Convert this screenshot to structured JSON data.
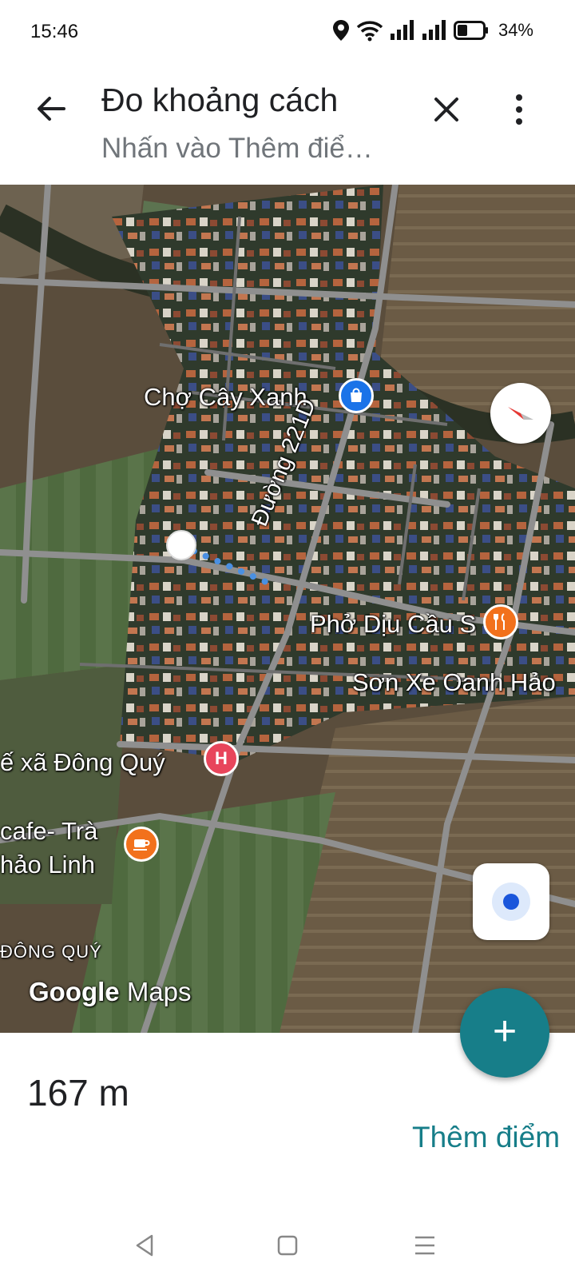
{
  "status_bar": {
    "time": "15:46",
    "battery_percent": "34%",
    "icons": [
      "location-icon",
      "wifi-icon",
      "signal-icon",
      "signal-icon",
      "battery-icon"
    ]
  },
  "header": {
    "title": "Đo khoảng cách",
    "subtitle": "Nhấn vào Thêm điể…",
    "icons": [
      "back-arrow-icon",
      "close-icon",
      "more-vert-icon"
    ]
  },
  "map": {
    "labels": {
      "market": "Chợ Cây Xanh",
      "road": "Đường 221D",
      "pho": "Phở Dịu Cầu S",
      "son_xe": "Sơn Xe Oanh Hảo",
      "clinic": "ế xã Đông Quý",
      "cafe_line1": "cafe- Trà",
      "cafe_line2": "hảo Linh",
      "area": "ĐÔNG QUÝ"
    },
    "poi_glyphs": {
      "hospital": "H"
    },
    "attribution": {
      "google": "Google",
      "maps": "Maps"
    },
    "colors": {
      "measure_line": "#4a90e2",
      "poi_shopping": "#1a73e8",
      "poi_food": "#f2711c",
      "poi_hospital": "#e8455b"
    }
  },
  "measurement": {
    "distance": "167 m",
    "add_point": "Thêm điểm"
  },
  "fab": {
    "symbol": "+"
  },
  "accent_color": "#177e89"
}
